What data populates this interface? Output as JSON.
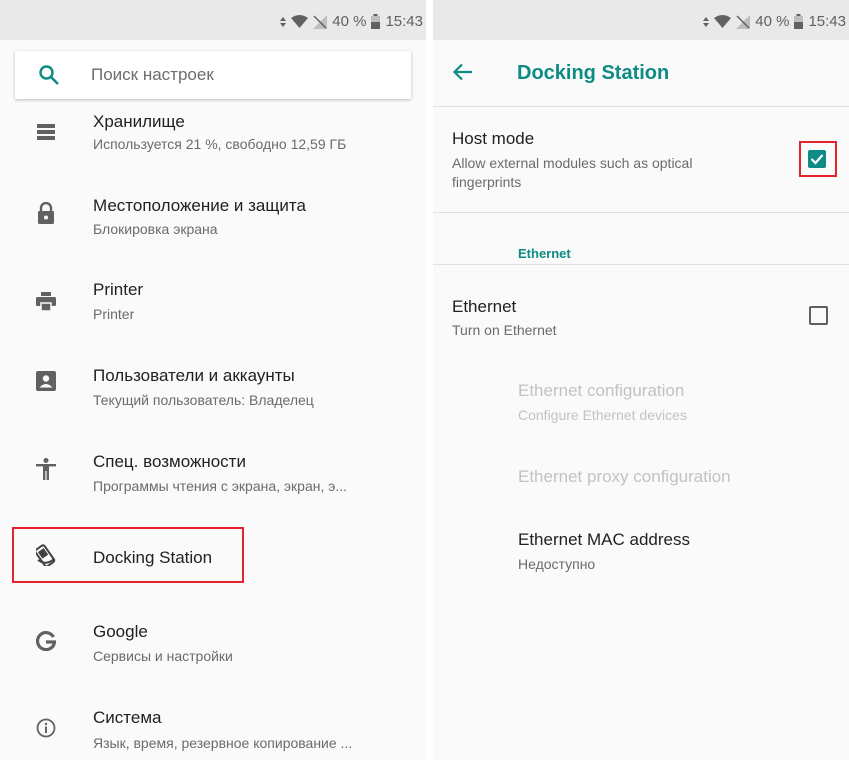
{
  "status": {
    "battery_percent": "40 %",
    "time": "15:43"
  },
  "search": {
    "placeholder": "Поиск настроек"
  },
  "settings_list": [
    {
      "icon": "storage-icon",
      "title": "Хранилище",
      "subtitle": "Используется 21 %, свободно 12,59 ГБ"
    },
    {
      "icon": "lock-icon",
      "title": "Местоположение и защита",
      "subtitle": "Блокировка экрана"
    },
    {
      "icon": "printer-icon",
      "title": "Printer",
      "subtitle": "Printer"
    },
    {
      "icon": "account-box-icon",
      "title": "Пользователи и аккаунты",
      "subtitle": "Текущий пользователь: Владелец"
    },
    {
      "icon": "accessibility-icon",
      "title": "Спец. возможности",
      "subtitle": "Программы чтения с экрана, экран, э..."
    },
    {
      "icon": "docking-station-icon",
      "title": "Docking Station",
      "subtitle": ""
    },
    {
      "icon": "google-icon",
      "title": "Google",
      "subtitle": "Сервисы и настройки"
    },
    {
      "icon": "info-icon",
      "title": "Система",
      "subtitle": "Язык, время, резервное копирование ..."
    }
  ],
  "docking": {
    "title": "Docking Station",
    "host_mode": {
      "title": "Host mode",
      "subtitle": "Allow external modules such as optical fingerprints",
      "checked": true
    },
    "category": "Ethernet",
    "ethernet": {
      "title": "Ethernet",
      "subtitle": "Turn on Ethernet",
      "checked": false
    },
    "ethernet_config": {
      "title": "Ethernet configuration",
      "subtitle": "Configure Ethernet devices"
    },
    "ethernet_proxy": {
      "title": "Ethernet proxy configuration"
    },
    "ethernet_mac": {
      "title": "Ethernet MAC address",
      "subtitle": "Недоступно"
    }
  },
  "colors": {
    "accent": "#0d8b84",
    "highlight": "#e0262c",
    "statusbar": "#e9e9e9"
  }
}
